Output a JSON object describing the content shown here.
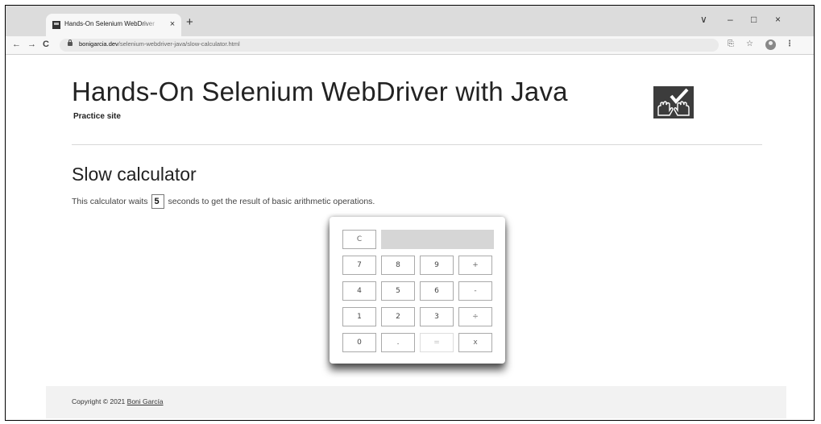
{
  "browser": {
    "tab_title": "Hands-On Selenium WebDriver",
    "tab_close": "×",
    "new_tab": "+",
    "url_host": "bonigarcia.dev",
    "url_path": "/selenium-webdriver-java/slow-calculator.html",
    "nav": {
      "back": "←",
      "forward": "→",
      "reload": "C"
    },
    "window_controls": {
      "tab_search": "∨",
      "minimize": "–",
      "maximize": "□",
      "close": "×"
    },
    "toolbar_icons": {
      "share": "⎘",
      "bookmark": "☆",
      "menu": "⋮"
    }
  },
  "header": {
    "title": "Hands-On Selenium WebDriver with Java",
    "subtitle": "Practice site"
  },
  "section": {
    "title": "Slow calculator",
    "desc_before": "This calculator waits",
    "delay_value": "5",
    "desc_after": "seconds to get the result of basic arithmetic operations."
  },
  "calculator": {
    "clear": "C",
    "screen": "",
    "keys": {
      "k7": "7",
      "k8": "8",
      "k9": "9",
      "plus": "+",
      "k4": "4",
      "k5": "5",
      "k6": "6",
      "minus": "-",
      "k1": "1",
      "k2": "2",
      "k3": "3",
      "divide": "÷",
      "k0": "0",
      "dot": ".",
      "equals": "=",
      "multiply": "x"
    }
  },
  "footer": {
    "copyright": "Copyright © 2021",
    "author": "Boni García"
  }
}
